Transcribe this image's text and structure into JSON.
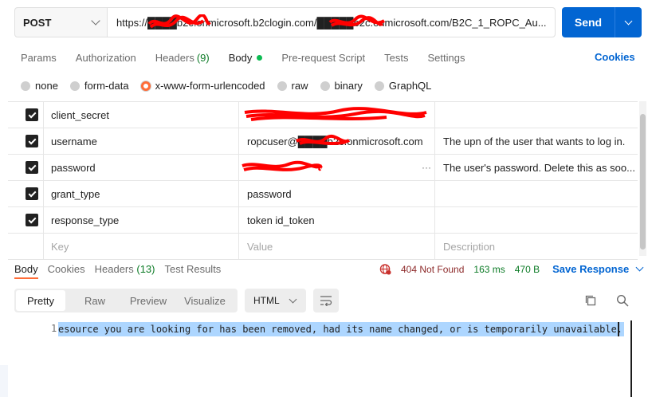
{
  "request": {
    "method": "POST",
    "url": "https://████b2c.onmicrosoft.b2clogin.com/█████b2c.onmicrosoft.com/B2C_1_ROPC_Au...",
    "send_label": "Send"
  },
  "request_tabs": [
    {
      "label": "Params"
    },
    {
      "label": "Authorization"
    },
    {
      "label": "Headers",
      "count": "(9)"
    },
    {
      "label": "Body"
    },
    {
      "label": "Pre-request Script"
    },
    {
      "label": "Tests"
    },
    {
      "label": "Settings"
    }
  ],
  "cookies_link": "Cookies",
  "body_types": [
    "none",
    "form-data",
    "x-www-form-urlencoded",
    "raw",
    "binary",
    "GraphQL"
  ],
  "params": [
    {
      "key": "client_secret",
      "value": "",
      "description": ""
    },
    {
      "key": "username",
      "value": "ropcuser@████b2c.onmicrosoft.com",
      "description": "The upn of the user that wants to log in."
    },
    {
      "key": "password",
      "value": "",
      "description": "The user's password.  Delete this as soo..."
    },
    {
      "key": "grant_type",
      "value": "password",
      "description": ""
    },
    {
      "key": "response_type",
      "value": "token id_token",
      "description": ""
    }
  ],
  "placeholders": {
    "key": "Key",
    "value": "Value",
    "description": "Description"
  },
  "response_tabs": [
    {
      "label": "Body"
    },
    {
      "label": "Cookies"
    },
    {
      "label": "Headers",
      "count": "(13)"
    },
    {
      "label": "Test Results"
    }
  ],
  "response_status": {
    "status": "404 Not Found",
    "time": "163 ms",
    "size": "470 B",
    "save_label": "Save Response"
  },
  "view_modes": [
    "Pretty",
    "Raw",
    "Preview",
    "Visualize"
  ],
  "format": "HTML",
  "code": {
    "line_number": "1",
    "text": "esource you are looking for has been removed, had its name changed, or is temporarily unavailable."
  },
  "colors": {
    "accent": "#ff6c37",
    "send": "#0265d2",
    "link": "#0265d2",
    "success": "#0c7b26",
    "error": "#8d2a2a",
    "redaction": "#ff0000"
  }
}
